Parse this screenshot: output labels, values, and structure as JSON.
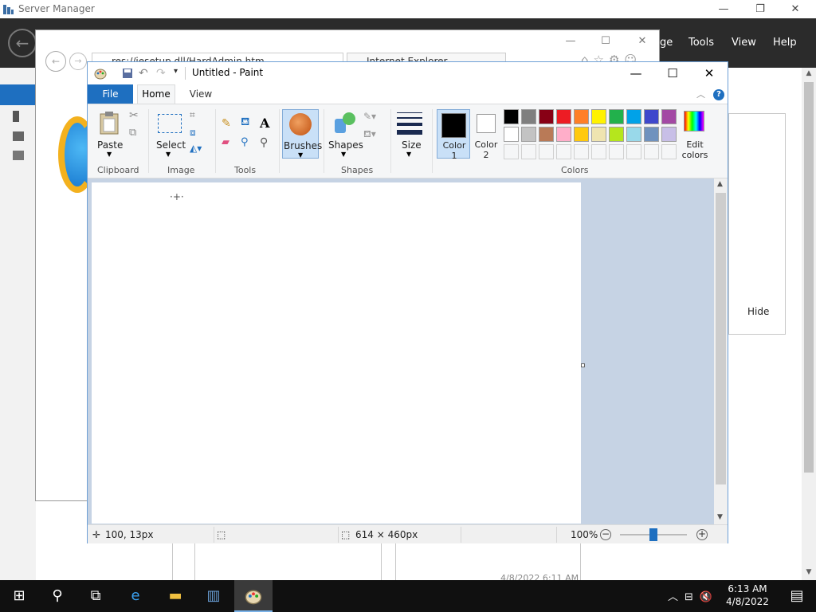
{
  "server_manager": {
    "title": "Server Manager",
    "menu": [
      "ge",
      "Tools",
      "View",
      "Help"
    ],
    "hide_label": "Hide",
    "timestamp": "4/8/2022 6:11 AM"
  },
  "ie": {
    "address": "res://iesetup.dll/HardAdmin.htm",
    "tab_title": "Internet Explorer Enhanced..."
  },
  "paint": {
    "title": "Untitled - Paint",
    "tabs": {
      "file": "File",
      "home": "Home",
      "view": "View"
    },
    "help": "?",
    "ribbon": {
      "paste": "Paste",
      "select": "Select",
      "brushes": "Brushes",
      "shapes": "Shapes",
      "size": "Size",
      "color1": "Color 1",
      "color2": "Color 2",
      "edit_colors": "Edit colors",
      "groups": {
        "clipboard": "Clipboard",
        "image": "Image",
        "tools": "Tools",
        "shapes": "Shapes",
        "colors": "Colors"
      }
    },
    "palette_row1": [
      "#000000",
      "#7f7f7f",
      "#880015",
      "#ed1c24",
      "#ff7f27",
      "#fff200",
      "#22b14c",
      "#00a2e8",
      "#3f48cc",
      "#a349a4"
    ],
    "palette_row2": [
      "#ffffff",
      "#c3c3c3",
      "#b97a57",
      "#ffaec9",
      "#ffc90e",
      "#efe4b0",
      "#b5e61d",
      "#99d9ea",
      "#7092be",
      "#c8bfe7"
    ],
    "status": {
      "cursor_pos": "100, 13px",
      "canvas_size": "614 × 460px",
      "zoom": "100%"
    }
  },
  "taskbar": {
    "time": "6:13 AM",
    "date": "4/8/2022"
  }
}
